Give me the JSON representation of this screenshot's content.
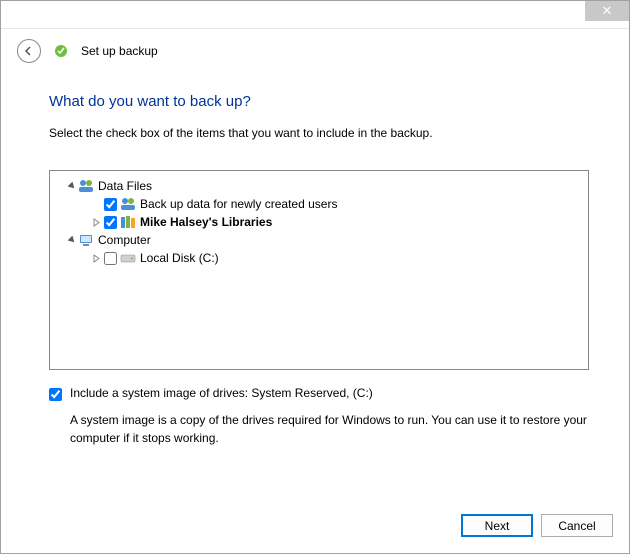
{
  "titlebar": {
    "close_glyph": "✕"
  },
  "header": {
    "title": "Set up backup"
  },
  "main": {
    "heading": "What do you want to back up?",
    "instruction": "Select the check box of the items that you want to include in the backup."
  },
  "tree": {
    "data_files": {
      "label": "Data Files",
      "child_new_users": {
        "label": "Back up data for newly created users",
        "checked": true
      },
      "child_libraries": {
        "label": "Mike Halsey's Libraries",
        "checked": true
      }
    },
    "computer": {
      "label": "Computer",
      "child_local_disk": {
        "label": "Local Disk (C:)",
        "checked": false
      }
    }
  },
  "system_image": {
    "label": "Include a system image of drives: System Reserved, (C:)",
    "checked": true,
    "description": "A system image is a copy of the drives required for Windows to run. You can use it to restore your computer if it stops working."
  },
  "buttons": {
    "next": "Next",
    "cancel": "Cancel"
  }
}
